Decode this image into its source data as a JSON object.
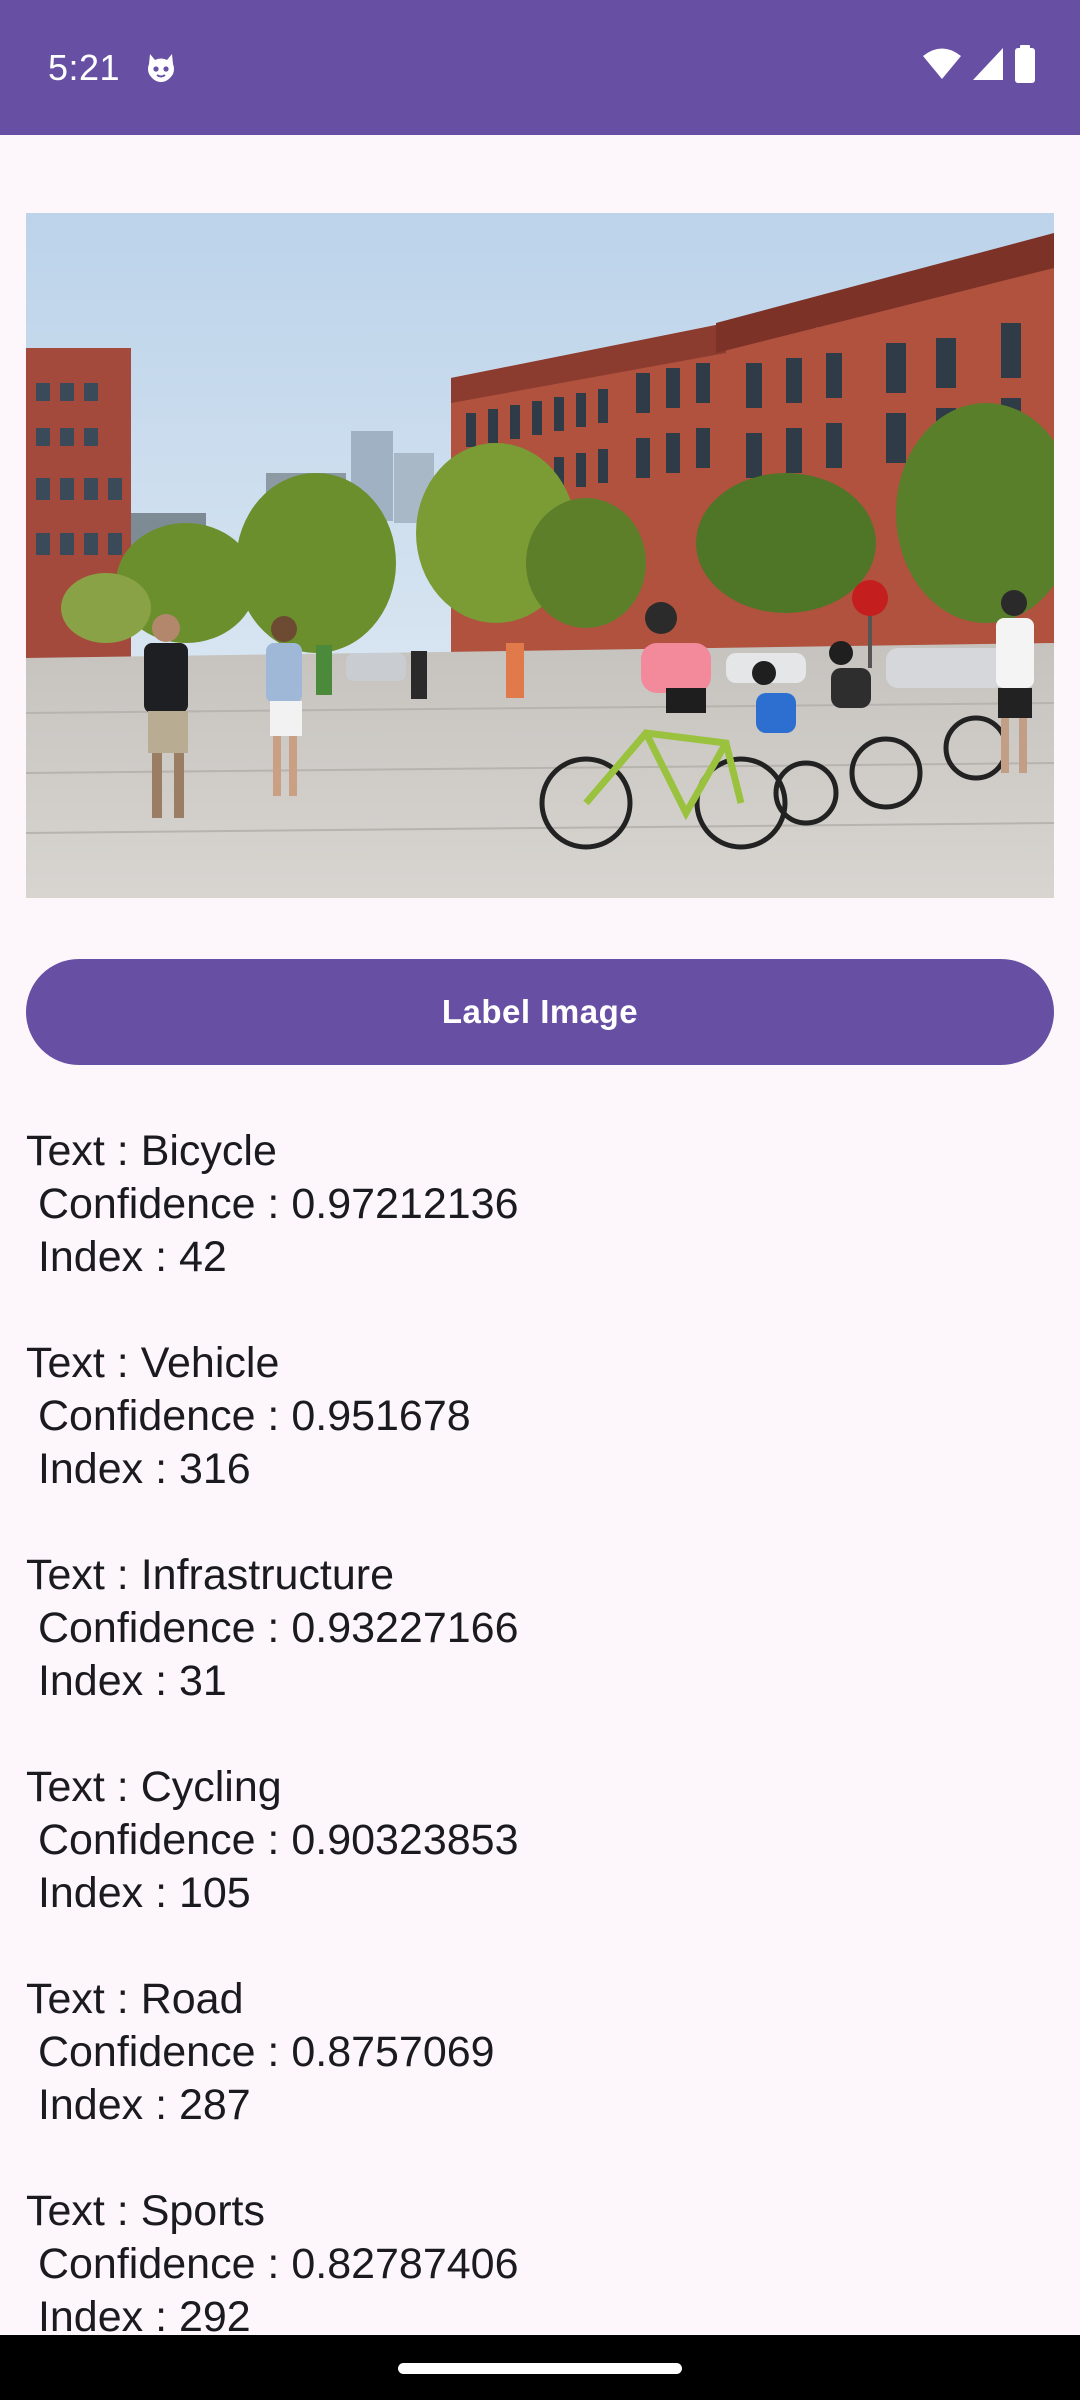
{
  "status_bar": {
    "time": "5:21",
    "background_color": "#6750a4",
    "icons": [
      "cat-face-icon",
      "wifi-icon",
      "cellular-signal-icon",
      "battery-icon"
    ]
  },
  "image": {
    "description_icon": "street-scene-photo"
  },
  "button": {
    "label": "Label Image",
    "color": "#6750a4"
  },
  "results": [
    {
      "text": "Text : Bicycle",
      "confidence": " Confidence : 0.97212136",
      "index": " Index : 42"
    },
    {
      "text": "Text : Vehicle",
      "confidence": " Confidence : 0.951678",
      "index": " Index : 316"
    },
    {
      "text": "Text : Infrastructure",
      "confidence": " Confidence : 0.93227166",
      "index": " Index : 31"
    },
    {
      "text": "Text : Cycling",
      "confidence": " Confidence : 0.90323853",
      "index": " Index : 105"
    },
    {
      "text": "Text : Road",
      "confidence": " Confidence : 0.8757069",
      "index": " Index : 287"
    },
    {
      "text": "Text : Sports",
      "confidence": " Confidence : 0.82787406",
      "index": " Index : 292"
    }
  ]
}
